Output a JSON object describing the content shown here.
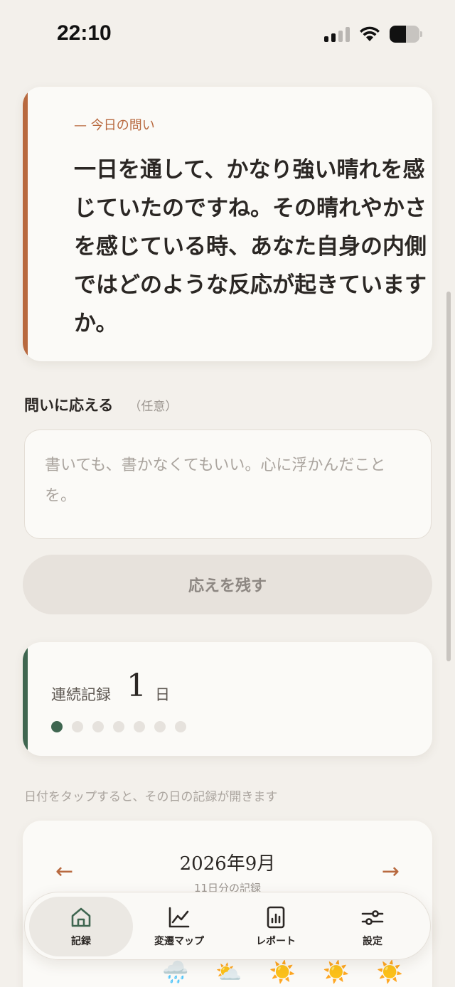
{
  "status": {
    "time": "22:10",
    "battery_level": 0.55
  },
  "question": {
    "kicker": "— 今日の問い",
    "text": "一日を通して、かなり強い晴れを感じていたのですね。その晴れやかさを感じている時、あなた自身の内側ではどのような反応が起きていますか。"
  },
  "answer": {
    "label": "問いに応える",
    "optional": "（任意）",
    "placeholder": "書いても、書かなくてもいい。心に浮かんだことを。",
    "submit_label": "応えを残す"
  },
  "streak": {
    "label": "連続記録",
    "count": "1",
    "unit": "日",
    "filled_dots": 1,
    "total_dots": 7
  },
  "hint": "日付をタップすると、その日の記録が開きます",
  "calendar": {
    "prev": "←",
    "next": "→",
    "month": "2026年9月",
    "subtitle": "11日分の記録",
    "weather": [
      "🌧️",
      "⛅",
      "☀️",
      "☀️",
      "☀️"
    ]
  },
  "nav": {
    "items": [
      {
        "label": "記録",
        "icon": "home-icon"
      },
      {
        "label": "変遷マップ",
        "icon": "line-chart-icon"
      },
      {
        "label": "レポート",
        "icon": "report-icon"
      },
      {
        "label": "設定",
        "icon": "sliders-icon"
      }
    ],
    "active_index": 0
  },
  "colors": {
    "accent_orange": "#b8693f",
    "accent_green": "#3f6650",
    "background": "#f3f0eb"
  }
}
